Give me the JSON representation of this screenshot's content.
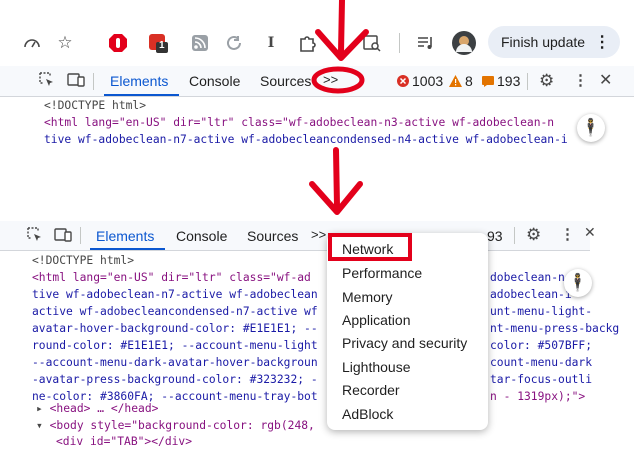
{
  "toolbar": {
    "finish_update_label": "Finish update",
    "extension_badge": "1",
    "icons": [
      "performance-gauge-icon",
      "bookmark-star-icon",
      "adblock-icon",
      "extension-icon",
      "rss-icon",
      "refresh-icon",
      "text-icon",
      "extensions-puzzle-icon",
      "reading-list-icon",
      "media-queue-icon",
      "profile-avatar-icon",
      "more-menu-icon"
    ]
  },
  "devtools_top": {
    "tabs": [
      "Elements",
      "Console",
      "Sources"
    ],
    "overflow_label": ">>",
    "errors": "1003",
    "warnings": "8",
    "issues": "193",
    "code_lines": [
      "<!DOCTYPE html>",
      "<html lang=\"en-US\" dir=\"ltr\" class=\"wf-adobeclean-n3-active wf-adobeclean-n",
      "tive wf-adobeclean-n7-active wf-adobecleancondensed-n4-active wf-adobeclean-i"
    ]
  },
  "devtools_bottom": {
    "tabs": [
      "Elements",
      "Console",
      "Sources"
    ],
    "overflow_label": ">>",
    "issues_partial": "93",
    "code_left": [
      "<!DOCTYPE html>",
      "<html lang=\"en-US\" dir=\"ltr\" class=\"wf-ad",
      "tive wf-adobeclean-n7-active wf-adobeclean",
      "active wf-adobecleancondensed-n7-active wf",
      "avatar-hover-background-color: #E1E1E1; --",
      "round-color: #E1E1E1; --account-menu-light",
      "--account-menu-dark-avatar-hover-backgroun",
      "-avatar-press-background-color: #323232; -",
      "ne-color: #3860FA; --account-menu-tray-bot"
    ],
    "code_right": [
      "",
      "dobeclean-n",
      "adobeclean-i",
      "unt-menu-light-",
      "nt-menu-press-backg",
      "color: #507BFF;",
      "count-menu-dark",
      "tar-focus-outli",
      "n - 1319px);\">"
    ],
    "head_line": "<head> … </head>",
    "body_line": "<body style=\"background-color: rgb(248,",
    "div_line": "<div id=\"TAB\"></div>"
  },
  "menu": {
    "items": [
      "Network",
      "Performance",
      "Memory",
      "Application",
      "Privacy and security",
      "Lighthouse",
      "Recorder",
      "AdBlock"
    ],
    "highlighted": "Network"
  },
  "colors": {
    "annotation": "#e3001b",
    "accent": "#0b57d0",
    "devtools_bar": "#f7f9fc"
  }
}
